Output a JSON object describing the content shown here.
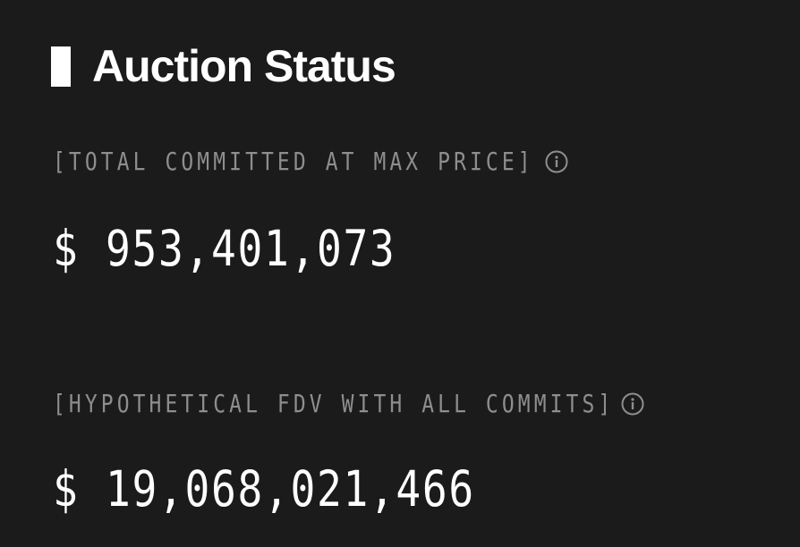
{
  "section": {
    "title": "Auction Status"
  },
  "stats": [
    {
      "label": "[TOTAL COMMITTED AT MAX PRICE]",
      "value": "$ 953,401,073",
      "icon": "info-icon"
    },
    {
      "label": "[HYPOTHETICAL FDV WITH ALL COMMITS]",
      "value": "$ 19,068,021,466",
      "icon": "info-icon"
    }
  ],
  "colors": {
    "background": "#1b1b1b",
    "text_primary": "#ffffff",
    "text_muted": "#8e8e8e"
  }
}
